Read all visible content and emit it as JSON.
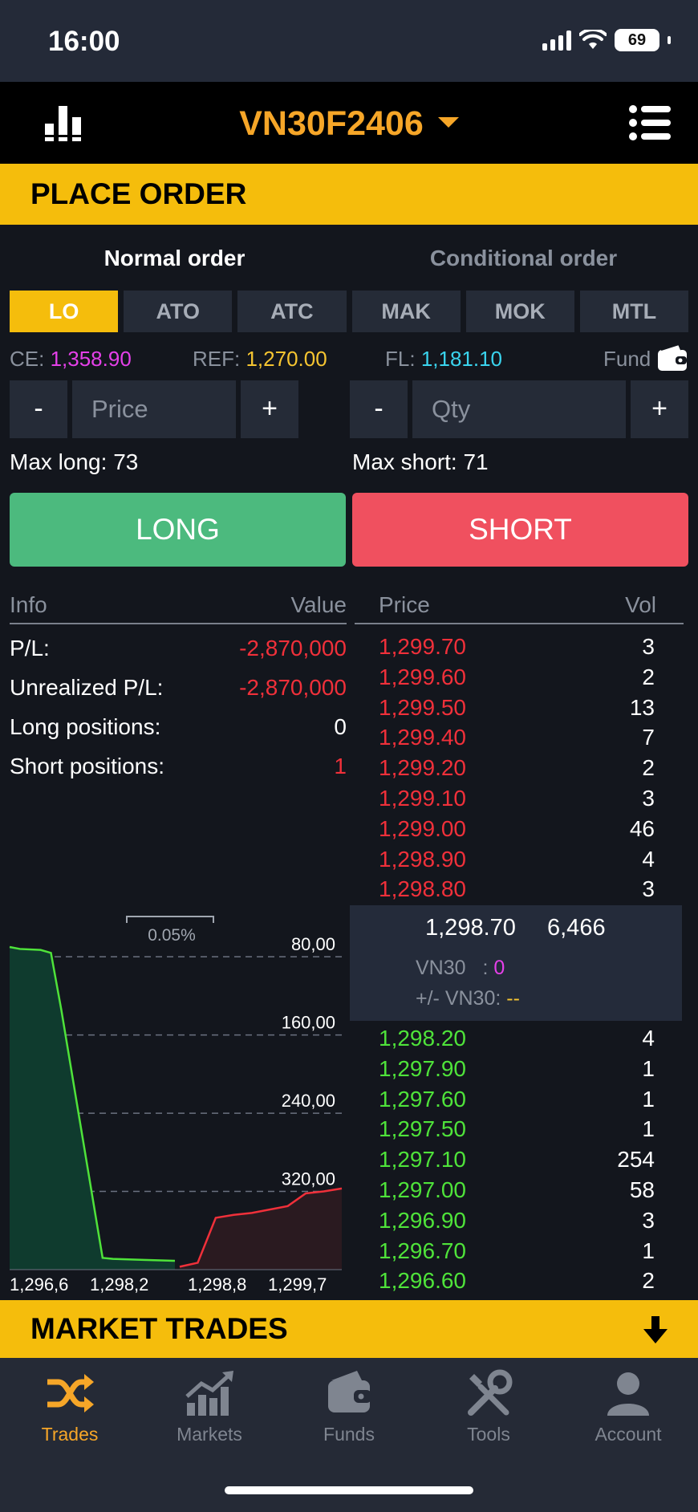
{
  "status_bar": {
    "time": "16:00",
    "battery": "69"
  },
  "header": {
    "symbol": "VN30F2406"
  },
  "place_order": {
    "title": "PLACE ORDER"
  },
  "order_tabs": [
    {
      "label": "Normal order",
      "active": true
    },
    {
      "label": "Conditional order",
      "active": false
    }
  ],
  "order_types": [
    {
      "label": "LO",
      "active": true
    },
    {
      "label": "ATO"
    },
    {
      "label": "ATC"
    },
    {
      "label": "MAK"
    },
    {
      "label": "MOK"
    },
    {
      "label": "MTL"
    }
  ],
  "prices": {
    "ce_label": "CE:",
    "ce_value": "1,358.90",
    "ref_label": "REF:",
    "ref_value": "1,270.00",
    "fl_label": "FL:",
    "fl_value": "1,181.10",
    "fund_label": "Fund"
  },
  "inputs": {
    "minus": "-",
    "plus": "+",
    "price_placeholder": "Price",
    "qty_placeholder": "Qty"
  },
  "max": {
    "long_label": "Max long:",
    "long_value": "73",
    "short_label": "Max short:",
    "short_value": "71"
  },
  "buttons": {
    "long": "LONG",
    "short": "SHORT"
  },
  "info": {
    "header_info": "Info",
    "header_value": "Value",
    "rows": [
      {
        "label": "P/L:",
        "value": "-2,870,000"
      },
      {
        "label": "Unrealized P/L:",
        "value": "-2,870,000"
      },
      {
        "label": "Long positions:",
        "value": "0"
      },
      {
        "label": "Short positions:",
        "value": "1"
      }
    ]
  },
  "orderbook": {
    "header_price": "Price",
    "header_vol": "Vol",
    "asks": [
      {
        "price": "1,299.70",
        "vol": "3"
      },
      {
        "price": "1,299.60",
        "vol": "2"
      },
      {
        "price": "1,299.50",
        "vol": "13"
      },
      {
        "price": "1,299.40",
        "vol": "7"
      },
      {
        "price": "1,299.20",
        "vol": "2"
      },
      {
        "price": "1,299.10",
        "vol": "3"
      },
      {
        "price": "1,299.00",
        "vol": "46"
      },
      {
        "price": "1,298.90",
        "vol": "4"
      },
      {
        "price": "1,298.80",
        "vol": "3"
      }
    ],
    "last_price": "1,298.70",
    "last_vol": "6,466",
    "vn30_label": "VN30",
    "vn30_sep": ":",
    "vn30_value": "0",
    "vn30_change_label": "+/- VN30:",
    "vn30_change_value": "--",
    "bids": [
      {
        "price": "1,298.20",
        "vol": "4"
      },
      {
        "price": "1,297.90",
        "vol": "1"
      },
      {
        "price": "1,297.60",
        "vol": "1"
      },
      {
        "price": "1,297.50",
        "vol": "1"
      },
      {
        "price": "1,297.10",
        "vol": "254"
      },
      {
        "price": "1,297.00",
        "vol": "58"
      },
      {
        "price": "1,296.90",
        "vol": "3"
      },
      {
        "price": "1,296.70",
        "vol": "1"
      },
      {
        "price": "1,296.60",
        "vol": "2"
      }
    ]
  },
  "depth_chart": {
    "spread_label": "0.05%",
    "y_labels": [
      "320,00",
      "240,00",
      "160,00",
      "80,00"
    ],
    "x_labels": [
      "1,296,6",
      "1,298,2",
      "1,298,8",
      "1,299,7"
    ]
  },
  "chart_data": {
    "type": "area",
    "title": "",
    "xlabel": "",
    "ylabel": "",
    "ylim": [
      0,
      330
    ],
    "y_ticks": [
      80,
      160,
      240,
      320
    ],
    "x_tick_labels": [
      "1,296,6",
      "1,298,2",
      "1,298,8",
      "1,299,7"
    ],
    "series": [
      {
        "color": "#4fe33a",
        "x": [
          1296.6,
          1296.7,
          1296.9,
          1297.0,
          1297.1,
          1297.5,
          1297.6,
          1297.9,
          1298.2
        ],
        "y": [
          330,
          328,
          327,
          324,
          266,
          12,
          11,
          10,
          9
        ]
      },
      {
        "color": "#f0303a",
        "x": [
          1298.8,
          1298.9,
          1299.0,
          1299.1,
          1299.2,
          1299.4,
          1299.5,
          1299.6,
          1299.7
        ],
        "y": [
          3,
          7,
          53,
          56,
          58,
          65,
          78,
          80,
          83
        ]
      }
    ],
    "grid": true
  },
  "market_trades": {
    "title": "MARKET TRADES"
  },
  "nav": [
    {
      "label": "Trades",
      "icon": "shuffle-icon",
      "active": true
    },
    {
      "label": "Markets",
      "icon": "growth-chart-icon"
    },
    {
      "label": "Funds",
      "icon": "wallet-icon"
    },
    {
      "label": "Tools",
      "icon": "tools-icon"
    },
    {
      "label": "Account",
      "icon": "user-icon"
    }
  ],
  "colors": {
    "accent": "#f5bd0c",
    "up": "#4fe33a",
    "down": "#f0303a",
    "long": "#4cba7e",
    "short": "#f0505f"
  }
}
